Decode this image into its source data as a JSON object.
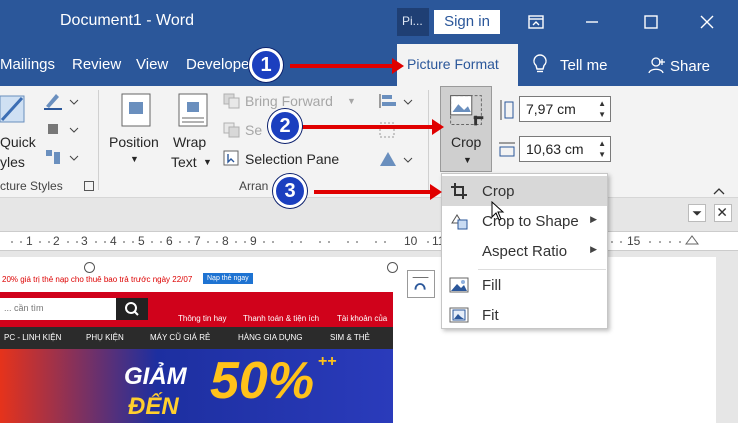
{
  "titlebar": {
    "title": "Document1  -  Word",
    "pi_tab": "Pi...",
    "signin": "Sign in"
  },
  "tabs": {
    "items": [
      "Mailings",
      "Review",
      "View",
      "Develope"
    ],
    "active": "Picture Format",
    "tell_me": "Tell me",
    "share": "Share"
  },
  "ribbon": {
    "quick": "Quick",
    "styles": "yles",
    "picture_styles": "cture Styles",
    "position": "Position",
    "wrap": "Wrap",
    "text": "Text",
    "bring_forward": "Bring Forward",
    "send_backward": "Se",
    "selection_pane": "Selection Pane",
    "arrange": "Arran",
    "crop": "Crop",
    "height": "7,97 cm",
    "width": "10,63 cm"
  },
  "menu": {
    "items": [
      {
        "label": "Crop",
        "submenu": false
      },
      {
        "label": "Crop to Shape",
        "submenu": true
      },
      {
        "label": "Aspect Ratio",
        "submenu": true
      },
      {
        "label": "Fill",
        "submenu": false
      },
      {
        "label": "Fit",
        "submenu": false
      }
    ]
  },
  "ruler": {
    "numbers": [
      "1",
      "2",
      "3",
      "4",
      "5",
      "6",
      "7",
      "8",
      "9",
      "10",
      "11",
      "15"
    ]
  },
  "picture": {
    "promo": "20% giá trị thẻ nạp cho thuê bao trả trước ngày 22/07",
    "promo_btn": "Nạp thẻ ngay",
    "search_placeholder": "... cần tìm",
    "nav_right": [
      "Thông tin hay",
      "Thanh toán & tiện ích",
      "Tài khoản của"
    ],
    "cats": [
      "PC - LINH KIỆN",
      "PHỤ KIỆN",
      "MÁY CŨ GIÁ RẺ",
      "HÀNG GIA DỤNG",
      "SIM & THẺ"
    ],
    "giam": "GIẢM",
    "den": "ĐẾN",
    "pct": "50%",
    "plus": "++"
  },
  "callouts": [
    "1",
    "2",
    "3"
  ],
  "colors": {
    "word_blue": "#2b579a",
    "callout_blue": "#1b3fbf",
    "arrow_red": "#e00000"
  }
}
